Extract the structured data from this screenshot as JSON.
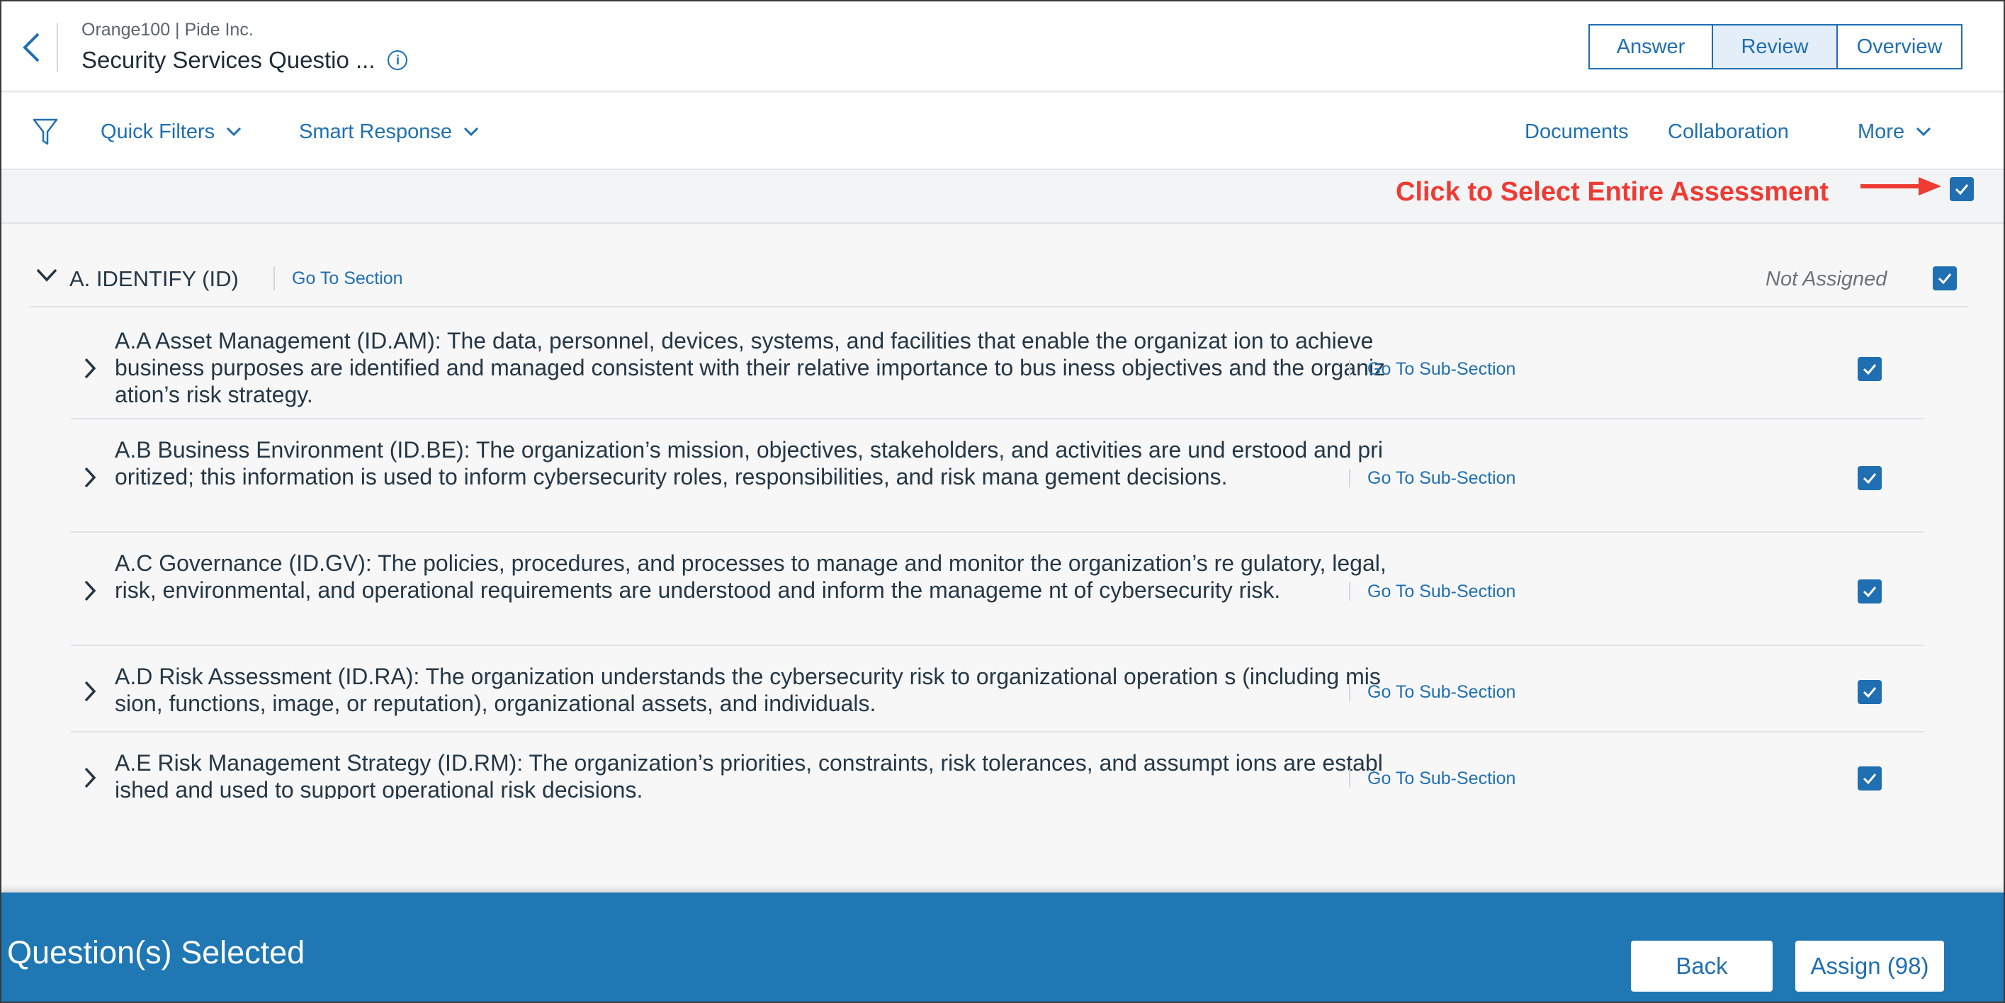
{
  "header": {
    "breadcrumb": "Orange100 | Pide Inc.",
    "title": "Security Services Questio ...",
    "tabs": [
      "Answer",
      "Review",
      "Overview"
    ],
    "active_tab": "Review"
  },
  "toolbar": {
    "quick_filters": "Quick Filters",
    "smart_response": "Smart Response",
    "documents": "Documents",
    "collaboration": "Collaboration",
    "more": "More"
  },
  "select_all": {
    "annotation": "Click to Select Entire Assessment",
    "checked": true
  },
  "section": {
    "title": "A. IDENTIFY (ID)",
    "go_to": "Go To Section",
    "status": "Not Assigned",
    "checked": true,
    "subsections": [
      {
        "text": "A.A Asset Management (ID.AM): The data, personnel, devices, systems, and facilities that enable the organizat ion to achieve business purposes are identified and managed consistent with their relative importance to bus iness objectives and the organization’s risk strategy.",
        "go_to": "Go To Sub-Section",
        "checked": true
      },
      {
        "text": "A.B Business Environment (ID.BE): The organization’s mission, objectives, stakeholders, and activities are und erstood and prioritized; this information is used to inform cybersecurity roles, responsibilities, and risk mana gement decisions.",
        "go_to": "Go To Sub-Section",
        "checked": true
      },
      {
        "text": "A.C Governance (ID.GV): The policies, procedures, and processes to manage and monitor the organization’s re gulatory, legal, risk, environmental, and operational requirements are understood and inform the manageme nt of cybersecurity risk.",
        "go_to": "Go To Sub-Section",
        "checked": true
      },
      {
        "text": "A.D Risk Assessment (ID.RA): The organization understands the cybersecurity risk to organizational operation s (including mission, functions, image, or reputation), organizational assets, and individuals.",
        "go_to": "Go To Sub-Section",
        "checked": true
      },
      {
        "text": "A.E Risk Management Strategy (ID.RM): The organization’s priorities, constraints, risk tolerances, and assumpt ions are established and used to support operational risk decisions.",
        "go_to": "Go To Sub-Section",
        "checked": true
      }
    ]
  },
  "footer": {
    "title": "Question(s) Selected",
    "back": "Back",
    "assign": "Assign (98)"
  },
  "colors": {
    "primary": "#1f6fb2",
    "footer_bg": "#1f77b4",
    "annotation": "#ee3b34",
    "text": "#253746"
  }
}
